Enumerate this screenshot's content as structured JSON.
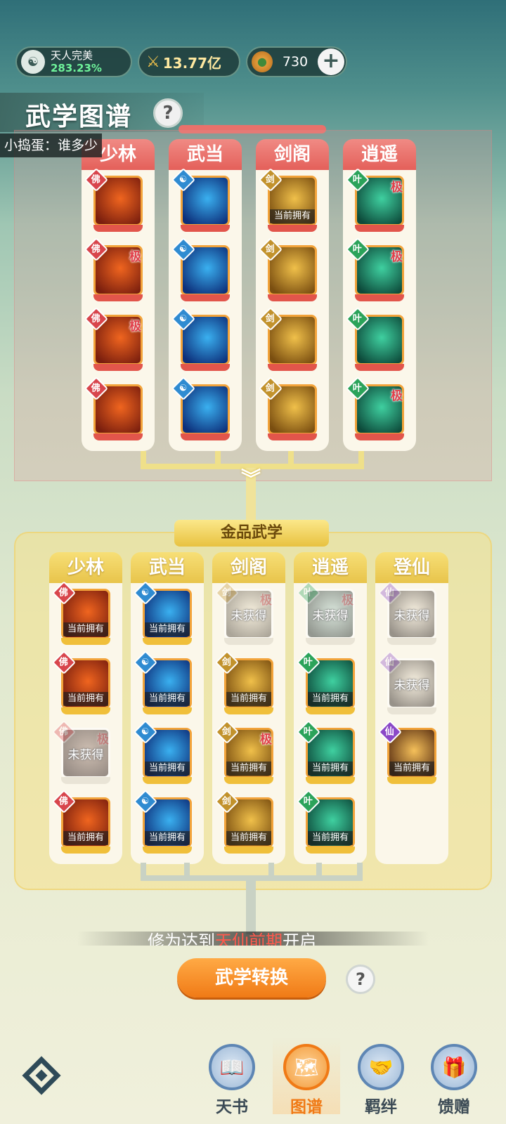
{
  "topbar": {
    "realm_name": "天人完美",
    "realm_percent": "283.23%",
    "power": "13.77亿",
    "jade": "730",
    "plus": "+"
  },
  "title": "武学图谱",
  "help": "?",
  "chat": "小捣蛋：谁多少",
  "upper": {
    "columns": [
      {
        "name": "少林",
        "school": "shaolin",
        "tiles": [
          {
            "ji": "",
            "owned": ""
          },
          {
            "ji": "极",
            "owned": ""
          },
          {
            "ji": "极",
            "owned": ""
          },
          {
            "ji": "",
            "owned": ""
          }
        ]
      },
      {
        "name": "武当",
        "school": "wudang",
        "tiles": [
          {
            "ji": "",
            "owned": ""
          },
          {
            "ji": "",
            "owned": ""
          },
          {
            "ji": "",
            "owned": ""
          },
          {
            "ji": "",
            "owned": ""
          }
        ]
      },
      {
        "name": "剑阁",
        "school": "jiange",
        "tiles": [
          {
            "ji": "",
            "owned": "当前拥有"
          },
          {
            "ji": "",
            "owned": ""
          },
          {
            "ji": "",
            "owned": ""
          },
          {
            "ji": "",
            "owned": ""
          }
        ]
      },
      {
        "name": "逍遥",
        "school": "xiaoyao",
        "tiles": [
          {
            "ji": "极",
            "owned": ""
          },
          {
            "ji": "极",
            "owned": ""
          },
          {
            "ji": "",
            "owned": ""
          },
          {
            "ji": "极",
            "owned": ""
          }
        ]
      }
    ]
  },
  "gold_tag": "金品武学",
  "lower": {
    "columns": [
      {
        "name": "少林",
        "school": "shaolin",
        "tiles": [
          {
            "state": "owned",
            "label": "当前拥有",
            "ji": ""
          },
          {
            "state": "owned",
            "label": "当前拥有",
            "ji": ""
          },
          {
            "state": "locked",
            "label": "未获得",
            "ji": "极"
          },
          {
            "state": "owned",
            "label": "当前拥有",
            "ji": ""
          }
        ]
      },
      {
        "name": "武当",
        "school": "wudang",
        "tiles": [
          {
            "state": "owned",
            "label": "当前拥有",
            "ji": ""
          },
          {
            "state": "owned",
            "label": "当前拥有",
            "ji": ""
          },
          {
            "state": "owned",
            "label": "当前拥有",
            "ji": ""
          },
          {
            "state": "owned",
            "label": "当前拥有",
            "ji": ""
          }
        ]
      },
      {
        "name": "剑阁",
        "school": "jiange",
        "tiles": [
          {
            "state": "locked",
            "label": "未获得",
            "ji": "极"
          },
          {
            "state": "owned",
            "label": "当前拥有",
            "ji": ""
          },
          {
            "state": "owned",
            "label": "当前拥有",
            "ji": "极"
          },
          {
            "state": "owned",
            "label": "当前拥有",
            "ji": ""
          }
        ]
      },
      {
        "name": "逍遥",
        "school": "xiaoyao",
        "tiles": [
          {
            "state": "locked",
            "label": "未获得",
            "ji": "极"
          },
          {
            "state": "owned",
            "label": "当前拥有",
            "ji": ""
          },
          {
            "state": "owned",
            "label": "当前拥有",
            "ji": ""
          },
          {
            "state": "owned",
            "label": "当前拥有",
            "ji": ""
          }
        ]
      },
      {
        "name": "登仙",
        "school": "dengxian",
        "tiles": [
          {
            "state": "locked",
            "label": "未获得",
            "ji": ""
          },
          {
            "state": "locked",
            "label": "未获得",
            "ji": ""
          },
          {
            "state": "owned",
            "label": "当前拥有",
            "ji": ""
          }
        ]
      }
    ]
  },
  "notice": {
    "prefix": "修为达到",
    "highlight": "天仙前期",
    "suffix": "开启"
  },
  "convert_button": "武学转换",
  "nav": [
    {
      "label": "天书",
      "icon": "book-icon"
    },
    {
      "label": "图谱",
      "icon": "scroll-map-icon"
    },
    {
      "label": "羁绊",
      "icon": "handshake-icon"
    },
    {
      "label": "馈赠",
      "icon": "gift-bag-icon"
    }
  ],
  "colors": {
    "shaolin": "#d8454c",
    "wudang": "#2f8bd1",
    "jiange": "#c2922c",
    "xiaoyao": "#2ba35a",
    "dengxian": "#8b48c7",
    "accent_orange": "#f07a16",
    "upper_header": "#e4605a",
    "lower_header": "#e8c44b"
  },
  "art_colors": {
    "shaolin": [
      "#f0651f",
      "#7a1e0e"
    ],
    "wudang": [
      "#3ab0f0",
      "#0d2f7a"
    ],
    "jiange": [
      "#f0c04a",
      "#7a4e10"
    ],
    "xiaoyao": [
      "#3fd0a0",
      "#0d4a3a"
    ],
    "dengxian": [
      "#f5c05a",
      "#5a2f12"
    ]
  }
}
